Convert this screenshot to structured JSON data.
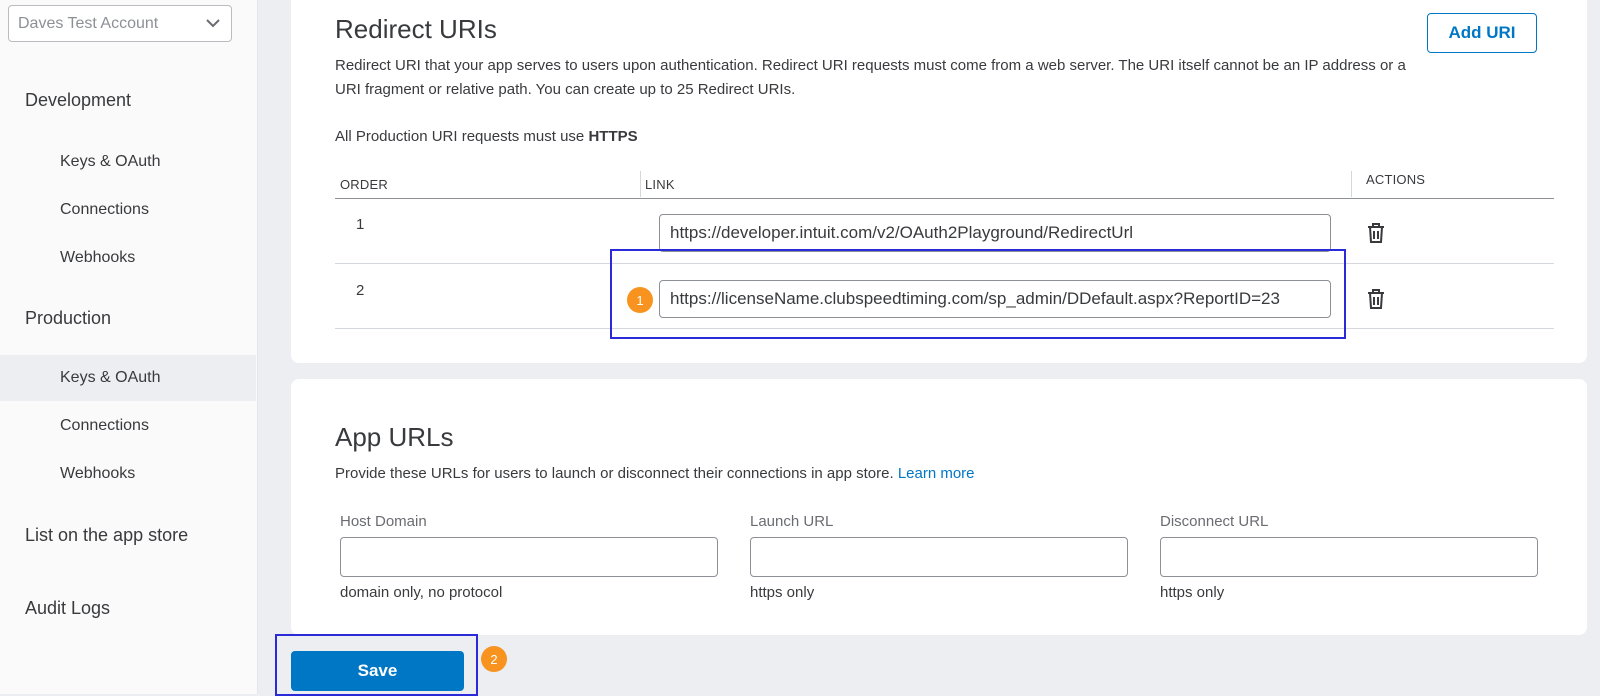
{
  "sidebar": {
    "account": "Daves Test Account",
    "development": {
      "heading": "Development",
      "items": [
        "Keys & OAuth",
        "Connections",
        "Webhooks"
      ]
    },
    "production": {
      "heading": "Production",
      "items": [
        "Keys & OAuth",
        "Connections",
        "Webhooks"
      ],
      "active_item": "Keys & OAuth"
    },
    "list_app_store": "List on the app store",
    "audit_logs": "Audit Logs"
  },
  "redirect": {
    "title": "Redirect URIs",
    "add_button": "Add URI",
    "description": "Redirect URI that your app serves to users upon authentication. Redirect URI requests must come from a web server. The URI itself cannot be an IP address or a URI fragment or relative path. You can create up to 25 Redirect URIs.",
    "https_note_prefix": "All Production URI requests must use",
    "https_note_bold": "HTTPS",
    "columns": [
      "ORDER",
      "LINK",
      "ACTIONS"
    ],
    "rows": [
      {
        "order": "1",
        "link": "https://developer.intuit.com/v2/OAuth2Playground/RedirectUrl"
      },
      {
        "order": "2",
        "link": "https://licenseName.clubspeedtiming.com/sp_admin/DDefault.aspx?ReportID=23"
      }
    ]
  },
  "app_urls": {
    "title": "App URLs",
    "description": "Provide these URLs for users to launch or disconnect their connections in app store.",
    "learn_more": "Learn more",
    "fields": [
      {
        "label": "Host Domain",
        "value": "",
        "hint": "domain only, no protocol"
      },
      {
        "label": "Launch URL",
        "value": "",
        "hint": "https only"
      },
      {
        "label": "Disconnect URL",
        "value": "",
        "hint": "https only"
      }
    ]
  },
  "save_button": "Save",
  "annotations": {
    "step1": "1",
    "step2": "2",
    "highlight_color": "#2a2ad8",
    "badge_color": "#f7931e"
  },
  "colors": {
    "accent": "#0077c5",
    "text": "#393a3d",
    "background": "#eceef1"
  },
  "icons": {
    "account_dropdown": "chevron-down-icon",
    "delete": "trash-icon"
  }
}
